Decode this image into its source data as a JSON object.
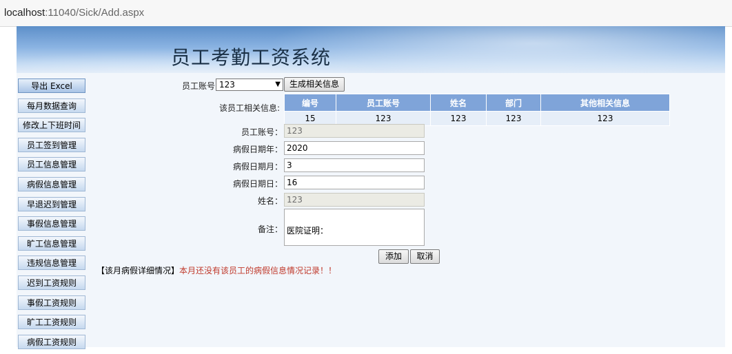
{
  "browser": {
    "url_host": "localhost",
    "url_rest": ":11040/Sick/Add.aspx"
  },
  "banner": {
    "title": "员工考勤工资系统"
  },
  "menu": {
    "items": [
      "导出 Excel",
      "每月数据查询",
      "修改上下班时间",
      "员工签到管理",
      "员工信息管理",
      "病假信息管理",
      "早退迟到管理",
      "事假信息管理",
      "旷工信息管理",
      "违规信息管理",
      "迟到工资规则",
      "事假工资规则",
      "旷工工资规则",
      "病假工资规则"
    ]
  },
  "form": {
    "account_select_label": "员工账号",
    "account_select_value": "123",
    "generate_button": "生成相关信息",
    "related_info_label": "该员工相关信息:",
    "table": {
      "headers": [
        "编号",
        "员工账号",
        "姓名",
        "部门",
        "其他相关信息"
      ],
      "row": [
        "15",
        "123",
        "123",
        "123",
        "123"
      ]
    },
    "employee_account_label": "员工账号：",
    "employee_account_value": "123",
    "year_label": "病假日期年：",
    "year_value": "2020",
    "month_label": "病假日期月：",
    "month_value": "3",
    "day_label": "病假日期日：",
    "day_value": "16",
    "name_label": "姓名：",
    "name_value": "123",
    "remark_label": "备注：",
    "remark_value": "医院证明：",
    "add_button": "添加",
    "cancel_button": "取消"
  },
  "detail": {
    "prefix": "【该月病假详细情况】",
    "message": "本月还没有该员工的病假信息情况记录！！"
  }
}
